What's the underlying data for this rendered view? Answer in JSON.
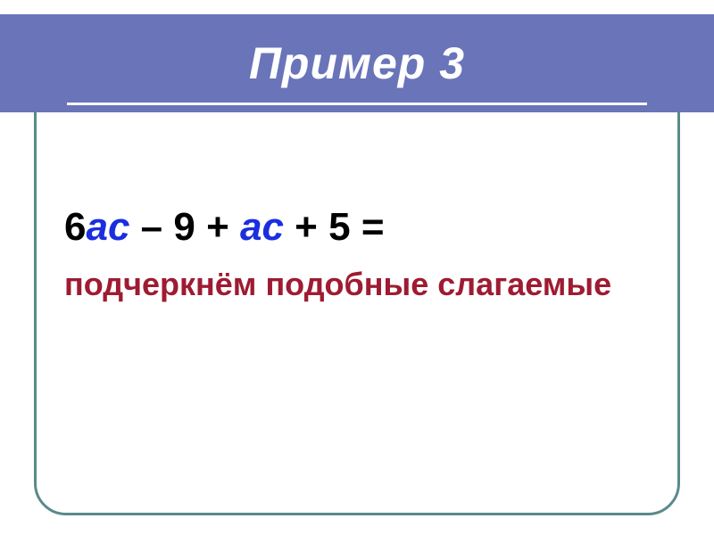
{
  "header": {
    "title": "Пример 3"
  },
  "equation": {
    "coef1": "6",
    "var1": "ac",
    "op1": " – ",
    "num1": "9",
    "op2": " + ",
    "var2": "ac",
    "op3": " + ",
    "num2": "5",
    "eq": " ="
  },
  "subtitle": "подчеркнём подобные слагаемые"
}
